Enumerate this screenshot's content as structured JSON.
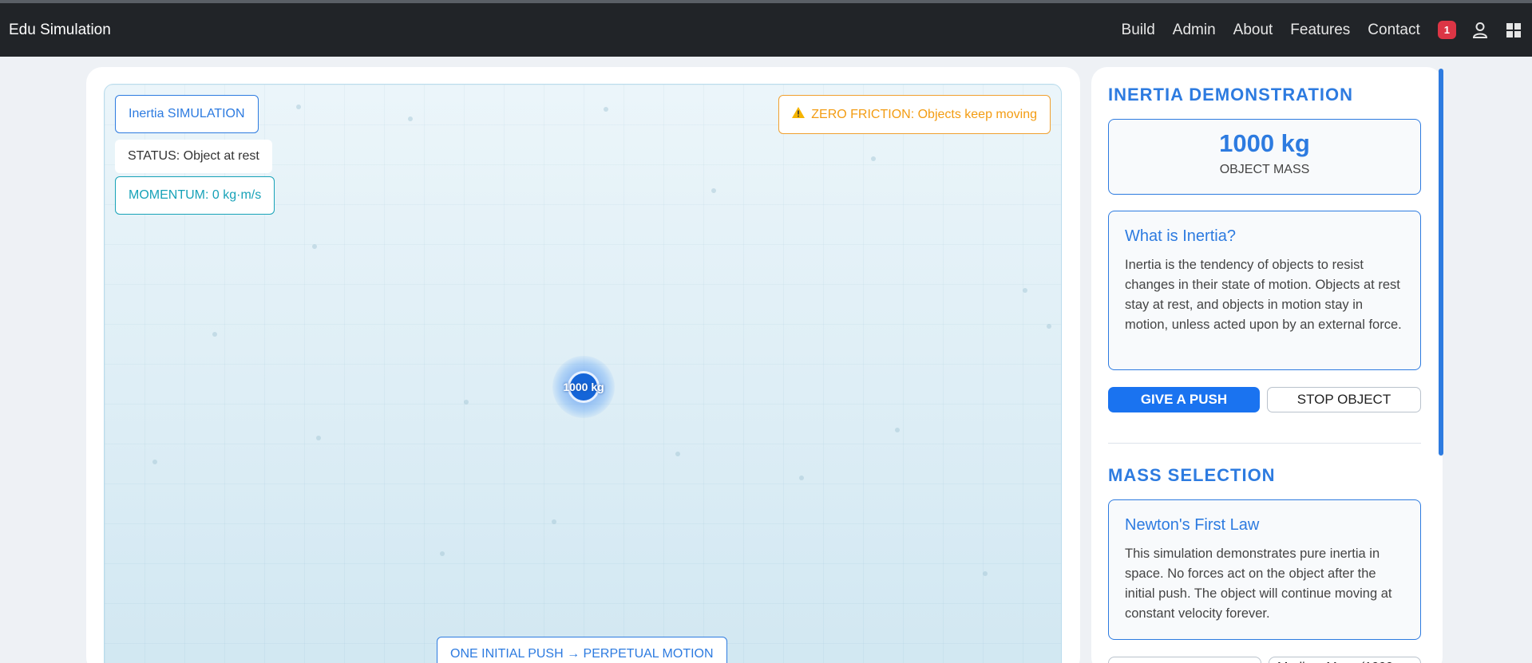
{
  "navbar": {
    "brand": "Edu Simulation",
    "links": [
      "Build",
      "Admin",
      "About",
      "Features",
      "Contact"
    ],
    "notification_count": "1",
    "icons": [
      "user-icon",
      "grid-icon"
    ]
  },
  "simulation": {
    "mode_label": "Inertia SIMULATION",
    "status": "STATUS: Object at rest",
    "momentum": "MOMENTUM: 0 kg·m/s",
    "friction_warning": "ZERO FRICTION: Objects keep moving",
    "object_label": "1000 kg",
    "bottom_label": "ONE INITIAL PUSH → PERPETUAL MOTION"
  },
  "panel": {
    "demo_title": "INERTIA DEMONSTRATION",
    "mass_value": "1000 kg",
    "mass_caption": "OBJECT MASS",
    "inertia_card": {
      "title": "What is Inertia?",
      "text": "Inertia is the tendency of objects to resist changes in their state of motion. Objects at rest stay at rest, and objects in motion stay in motion, unless acted upon by an external force."
    },
    "push_button": "GIVE A PUSH",
    "stop_button": "STOP OBJECT",
    "mass_section_title": "MASS SELECTION",
    "newton_card": {
      "title": "Newton's First Law",
      "text": "This simulation demonstrates pure inertia in space. No forces act on the object after the initial push. The object will continue moving at constant velocity forever."
    },
    "mass_options": [
      "",
      "Medium Mass (1000"
    ]
  },
  "colors": {
    "accent": "#2d7be0",
    "navbar_bg": "#212428",
    "warning": "#f39c12",
    "info": "#17a2b8",
    "badge": "#dc3545"
  }
}
